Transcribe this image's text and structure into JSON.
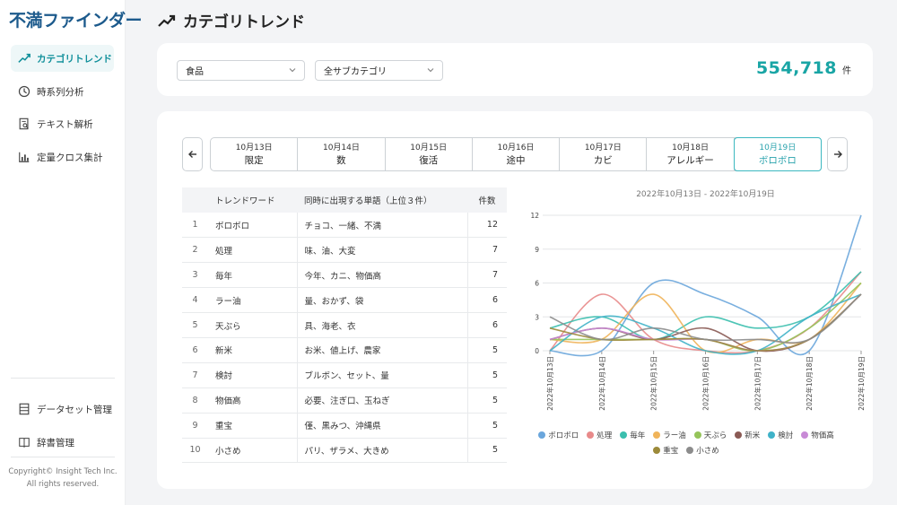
{
  "app": {
    "logo": "不満ファインダー"
  },
  "sidebar": {
    "items": [
      {
        "label": "カテゴリトレンド",
        "icon": "trend-icon",
        "active": true
      },
      {
        "label": "時系列分析",
        "icon": "clock-icon",
        "active": false
      },
      {
        "label": "テキスト解析",
        "icon": "document-search-icon",
        "active": false
      },
      {
        "label": "定量クロス集計",
        "icon": "bar-chart-icon",
        "active": false
      }
    ],
    "bottom_items": [
      {
        "label": "データセット管理",
        "icon": "dataset-icon"
      },
      {
        "label": "辞書管理",
        "icon": "book-icon"
      }
    ],
    "copyright_line1": "Copyright© Insight Tech Inc.",
    "copyright_line2": "All rights reserved."
  },
  "header": {
    "title": "カテゴリトレンド",
    "icon": "trend-icon"
  },
  "filters": {
    "category": "食品",
    "subcategory": "全サブカテゴリ",
    "total_count": "554,718",
    "total_unit": "件"
  },
  "date_tabs": [
    {
      "date": "10月13日",
      "word": "限定"
    },
    {
      "date": "10月14日",
      "word": "数"
    },
    {
      "date": "10月15日",
      "word": "復活"
    },
    {
      "date": "10月16日",
      "word": "途中"
    },
    {
      "date": "10月17日",
      "word": "カビ"
    },
    {
      "date": "10月18日",
      "word": "アレルギー"
    },
    {
      "date": "10月19日",
      "word": "ボロボロ",
      "active": true
    }
  ],
  "table": {
    "headers": {
      "rank": "",
      "word": "トレンドワード",
      "co": "同時に出現する単語（上位３件）",
      "count": "件数"
    },
    "rows": [
      {
        "rank": "1",
        "word": "ボロボロ",
        "co": "チョコ、一緒、不満",
        "count": "12"
      },
      {
        "rank": "2",
        "word": "処理",
        "co": "味、油、大変",
        "count": "7"
      },
      {
        "rank": "3",
        "word": "毎年",
        "co": "今年、カニ、物価高",
        "count": "7"
      },
      {
        "rank": "4",
        "word": "ラー油",
        "co": "量、おかず、袋",
        "count": "6"
      },
      {
        "rank": "5",
        "word": "天ぷら",
        "co": "具、海老、衣",
        "count": "6"
      },
      {
        "rank": "6",
        "word": "新米",
        "co": "お米、値上げ、農家",
        "count": "5"
      },
      {
        "rank": "7",
        "word": "検討",
        "co": "ブルボン、セット、量",
        "count": "5"
      },
      {
        "rank": "8",
        "word": "物価高",
        "co": "必要、注ぎ口、玉ねぎ",
        "count": "5"
      },
      {
        "rank": "9",
        "word": "重宝",
        "co": "僅、黒みつ、沖縄県",
        "count": "5"
      },
      {
        "rank": "10",
        "word": "小さめ",
        "co": "パリ、ザラメ、大きめ",
        "count": "5"
      }
    ]
  },
  "chart_data": {
    "type": "line",
    "title": "2022年10月13日 - 2022年10月19日",
    "x": [
      "2022年10月13日",
      "2022年10月14日",
      "2022年10月15日",
      "2022年10月16日",
      "2022年10月17日",
      "2022年10月18日",
      "2022年10月19日"
    ],
    "yticks": [
      0,
      3,
      6,
      9,
      12
    ],
    "ylim": [
      0,
      12
    ],
    "grid": true,
    "legend_position": "bottom",
    "series": [
      {
        "name": "ボロボロ",
        "color": "#6aa6dc",
        "values": [
          0,
          0,
          6,
          5,
          3,
          0,
          12
        ]
      },
      {
        "name": "処理",
        "color": "#e88a8a",
        "values": [
          0,
          5,
          1,
          0,
          0,
          2,
          7
        ]
      },
      {
        "name": "毎年",
        "color": "#3bbfae",
        "values": [
          2,
          3,
          1,
          3,
          2,
          3,
          7
        ]
      },
      {
        "name": "ラー油",
        "color": "#f0b45a",
        "values": [
          1,
          1,
          5,
          0,
          1,
          1,
          6
        ]
      },
      {
        "name": "天ぷら",
        "color": "#95c45a",
        "values": [
          1,
          1,
          1,
          1,
          0,
          2,
          6
        ]
      },
      {
        "name": "新米",
        "color": "#8a5a54",
        "values": [
          1,
          2,
          1,
          2,
          0,
          1,
          5
        ]
      },
      {
        "name": "検討",
        "color": "#3fb2c8",
        "values": [
          0,
          3,
          2,
          0,
          0,
          3,
          5
        ]
      },
      {
        "name": "物価高",
        "color": "#c88ad6",
        "values": [
          1,
          2,
          1,
          1,
          0,
          1,
          5
        ]
      },
      {
        "name": "重宝",
        "color": "#9c8a3a",
        "values": [
          2,
          1,
          1,
          1,
          0,
          1,
          5
        ]
      },
      {
        "name": "小さめ",
        "color": "#8c8c8c",
        "values": [
          3,
          1,
          2,
          1,
          1,
          1,
          5
        ]
      }
    ]
  }
}
